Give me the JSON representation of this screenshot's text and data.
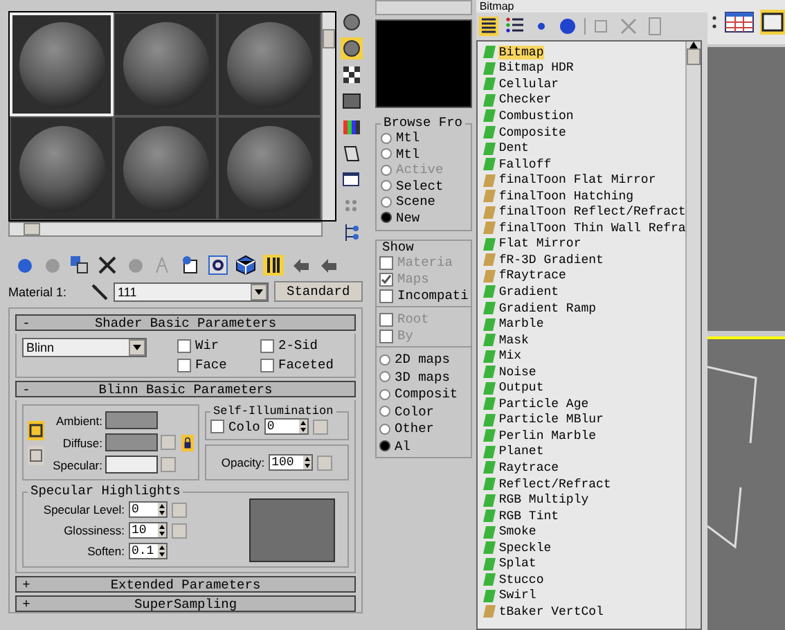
{
  "material_editor": {
    "sample_slots": [
      {
        "selected": true
      },
      {
        "selected": false
      },
      {
        "selected": false
      },
      {
        "selected": false
      },
      {
        "selected": false
      },
      {
        "selected": false
      }
    ],
    "material_label": "Material 1:",
    "material_name": "111",
    "material_type": "Standard",
    "shader_rollout": {
      "toggle": "-",
      "title": "Shader Basic Parameters",
      "shader": "Blinn",
      "options": [
        {
          "label": "Wir",
          "checked": false
        },
        {
          "label": "2-Sid",
          "checked": false
        },
        {
          "label": "Face",
          "checked": false
        },
        {
          "label": "Faceted",
          "checked": false
        }
      ]
    },
    "basic_rollout": {
      "toggle": "-",
      "title": "Blinn Basic Parameters",
      "colors": [
        {
          "label": "Ambient:",
          "color": "#8e8e8e"
        },
        {
          "label": "Diffuse:",
          "color": "#8e8e8e"
        },
        {
          "label": "Specular:",
          "color": "#eeeeee"
        }
      ],
      "self_illumination": {
        "title": "Self-Illumination",
        "label": "Colo",
        "checked": false,
        "value": "0"
      },
      "opacity": {
        "label": "Opacity:",
        "value": "100"
      },
      "highlights": {
        "title": "Specular Highlights",
        "fields": [
          {
            "label": "Specular Level:",
            "value": "0"
          },
          {
            "label": "Glossiness:",
            "value": "10"
          },
          {
            "label": "Soften:",
            "value": "0.1"
          }
        ]
      }
    },
    "collapsed_rollouts": [
      {
        "toggle": "+",
        "title": "Extended Parameters"
      },
      {
        "toggle": "+",
        "title": "SuperSampling"
      }
    ]
  },
  "browser": {
    "name": "Bitmap",
    "browse_from": {
      "title": "Browse Fro",
      "options": [
        {
          "label": "Mtl",
          "selected": false,
          "disabled": false
        },
        {
          "label": "Mtl",
          "selected": false,
          "disabled": false
        },
        {
          "label": "Active",
          "selected": false,
          "disabled": true
        },
        {
          "label": "Select",
          "selected": false,
          "disabled": false
        },
        {
          "label": "Scene",
          "selected": false,
          "disabled": false
        },
        {
          "label": "New",
          "selected": true,
          "disabled": false
        }
      ]
    },
    "show": {
      "title": "Show",
      "options": [
        {
          "label": "Materia",
          "checked": false,
          "disabled": true
        },
        {
          "label": "Maps",
          "checked": true,
          "disabled": true
        },
        {
          "label": "Incompati",
          "checked": false,
          "disabled": false
        }
      ]
    },
    "root_options": [
      {
        "label": "Root",
        "checked": false,
        "disabled": true
      },
      {
        "label": "By",
        "checked": false,
        "disabled": true
      }
    ],
    "filters": [
      {
        "label": "2D maps",
        "selected": false
      },
      {
        "label": "3D maps",
        "selected": false
      },
      {
        "label": "Composit",
        "selected": false
      },
      {
        "label": "Color",
        "selected": false
      },
      {
        "label": "Other",
        "selected": false
      },
      {
        "label": "Al",
        "selected": true
      }
    ],
    "maps": [
      {
        "label": "Bitmap",
        "color": "#3cb43c",
        "selected": true
      },
      {
        "label": "Bitmap HDR",
        "color": "#3cb43c",
        "selected": false
      },
      {
        "label": "Cellular",
        "color": "#3cb43c",
        "selected": false
      },
      {
        "label": "Checker",
        "color": "#3cb43c",
        "selected": false
      },
      {
        "label": "Combustion",
        "color": "#3cb43c",
        "selected": false
      },
      {
        "label": "Composite",
        "color": "#3cb43c",
        "selected": false
      },
      {
        "label": "Dent",
        "color": "#3cb43c",
        "selected": false
      },
      {
        "label": "Falloff",
        "color": "#3cb43c",
        "selected": false
      },
      {
        "label": "finalToon Flat Mirror",
        "color": "#c8a050",
        "selected": false
      },
      {
        "label": "finalToon Hatching",
        "color": "#c8a050",
        "selected": false
      },
      {
        "label": "finalToon Reflect/Refract",
        "color": "#c8a050",
        "selected": false
      },
      {
        "label": "finalToon Thin Wall Refra",
        "color": "#c8a050",
        "selected": false
      },
      {
        "label": "Flat Mirror",
        "color": "#3cb43c",
        "selected": false
      },
      {
        "label": "fR-3D Gradient",
        "color": "#c8a050",
        "selected": false
      },
      {
        "label": "fRaytrace",
        "color": "#c8a050",
        "selected": false
      },
      {
        "label": "Gradient",
        "color": "#3cb43c",
        "selected": false
      },
      {
        "label": "Gradient Ramp",
        "color": "#3cb43c",
        "selected": false
      },
      {
        "label": "Marble",
        "color": "#3cb43c",
        "selected": false
      },
      {
        "label": "Mask",
        "color": "#3cb43c",
        "selected": false
      },
      {
        "label": "Mix",
        "color": "#3cb43c",
        "selected": false
      },
      {
        "label": "Noise",
        "color": "#3cb43c",
        "selected": false
      },
      {
        "label": "Output",
        "color": "#3cb43c",
        "selected": false
      },
      {
        "label": "Particle Age",
        "color": "#3cb43c",
        "selected": false
      },
      {
        "label": "Particle MBlur",
        "color": "#3cb43c",
        "selected": false
      },
      {
        "label": "Perlin Marble",
        "color": "#3cb43c",
        "selected": false
      },
      {
        "label": "Planet",
        "color": "#3cb43c",
        "selected": false
      },
      {
        "label": "Raytrace",
        "color": "#3cb43c",
        "selected": false
      },
      {
        "label": "Reflect/Refract",
        "color": "#3cb43c",
        "selected": false
      },
      {
        "label": "RGB Multiply",
        "color": "#3cb43c",
        "selected": false
      },
      {
        "label": "RGB Tint",
        "color": "#3cb43c",
        "selected": false
      },
      {
        "label": "Smoke",
        "color": "#3cb43c",
        "selected": false
      },
      {
        "label": "Speckle",
        "color": "#3cb43c",
        "selected": false
      },
      {
        "label": "Splat",
        "color": "#3cb43c",
        "selected": false
      },
      {
        "label": "Stucco",
        "color": "#3cb43c",
        "selected": false
      },
      {
        "label": "Swirl",
        "color": "#3cb43c",
        "selected": false
      },
      {
        "label": "tBaker VertCol",
        "color": "#c8a050",
        "selected": false
      }
    ]
  }
}
